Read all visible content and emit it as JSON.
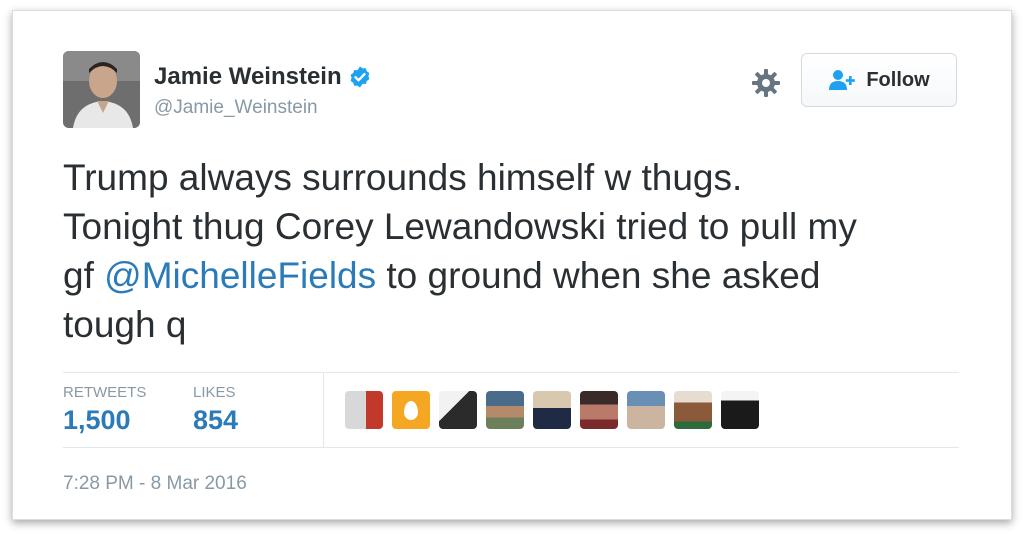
{
  "author": {
    "name": "Jamie Weinstein",
    "handle": "@Jamie_Weinstein",
    "verified": true
  },
  "actions": {
    "follow_label": "Follow"
  },
  "tweet": {
    "line1": "Trump always surrounds himself w thugs.",
    "line2": "Tonight thug Corey Lewandowski tried to pull my",
    "line3_pre": "gf ",
    "mention": "@MichelleFields",
    "line3_post": " to ground when she asked",
    "line4": "tough q"
  },
  "stats": {
    "retweets_label": "RETWEETS",
    "retweets_value": "1,500",
    "likes_label": "LIKES",
    "likes_value": "854"
  },
  "timestamp": "7:28 PM - 8 Mar 2016",
  "colors": {
    "link": "#2b7bb9",
    "text": "#292f33",
    "muted": "#8899a6",
    "verified": "#1da1f2"
  },
  "icons": [
    "verified-badge-icon",
    "gear-icon",
    "follow-person-icon"
  ]
}
